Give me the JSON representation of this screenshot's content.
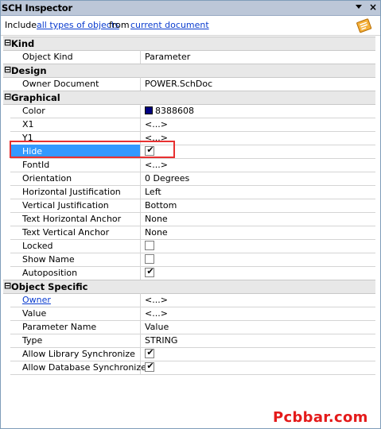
{
  "window": {
    "title": "SCH Inspector",
    "close_glyph": "×"
  },
  "include": {
    "prefix": "Include",
    "filter_link": "all types of objects",
    "middle": "from",
    "scope_link": "current document"
  },
  "categories": {
    "kind": {
      "label": "Kind",
      "sign": "⊟"
    },
    "design": {
      "label": "Design",
      "sign": "⊟"
    },
    "graphical": {
      "label": "Graphical",
      "sign": "⊟"
    },
    "object_specific": {
      "label": "Object Specific",
      "sign": "⊟"
    }
  },
  "properties": {
    "object_kind": {
      "name": "Object Kind",
      "value": "Parameter"
    },
    "owner_document": {
      "name": "Owner Document",
      "value": "POWER.SchDoc"
    },
    "color": {
      "name": "Color",
      "value": "8388608",
      "swatch": "#000080"
    },
    "x1": {
      "name": "X1",
      "value": "<...>"
    },
    "y1": {
      "name": "Y1",
      "value": "<...>"
    },
    "hide": {
      "name": "Hide",
      "checked": true
    },
    "fontid": {
      "name": "FontId",
      "value": "<...>"
    },
    "orientation": {
      "name": "Orientation",
      "value": "0 Degrees"
    },
    "h_just": {
      "name": "Horizontal Justification",
      "value": "Left"
    },
    "v_just": {
      "name": "Vertical Justification",
      "value": "Bottom"
    },
    "t_h_anchor": {
      "name": "Text Horizontal Anchor",
      "value": "None"
    },
    "t_v_anchor": {
      "name": "Text Vertical Anchor",
      "value": "None"
    },
    "locked": {
      "name": "Locked",
      "checked": false
    },
    "show_name": {
      "name": "Show Name",
      "checked": false
    },
    "autoposition": {
      "name": "Autoposition",
      "checked": true
    },
    "owner": {
      "name": "Owner",
      "value": "<...>"
    },
    "value": {
      "name": "Value",
      "value": "<...>"
    },
    "parameter_name": {
      "name": "Parameter Name",
      "value": "Value"
    },
    "type": {
      "name": "Type",
      "value": "STRING"
    },
    "allow_lib_sync": {
      "name": "Allow Library Synchronize",
      "checked": true
    },
    "allow_db_sync": {
      "name": "Allow Database Synchronize",
      "checked": true
    }
  },
  "check_glyph": "✔",
  "watermark": "Pcbbar.com"
}
